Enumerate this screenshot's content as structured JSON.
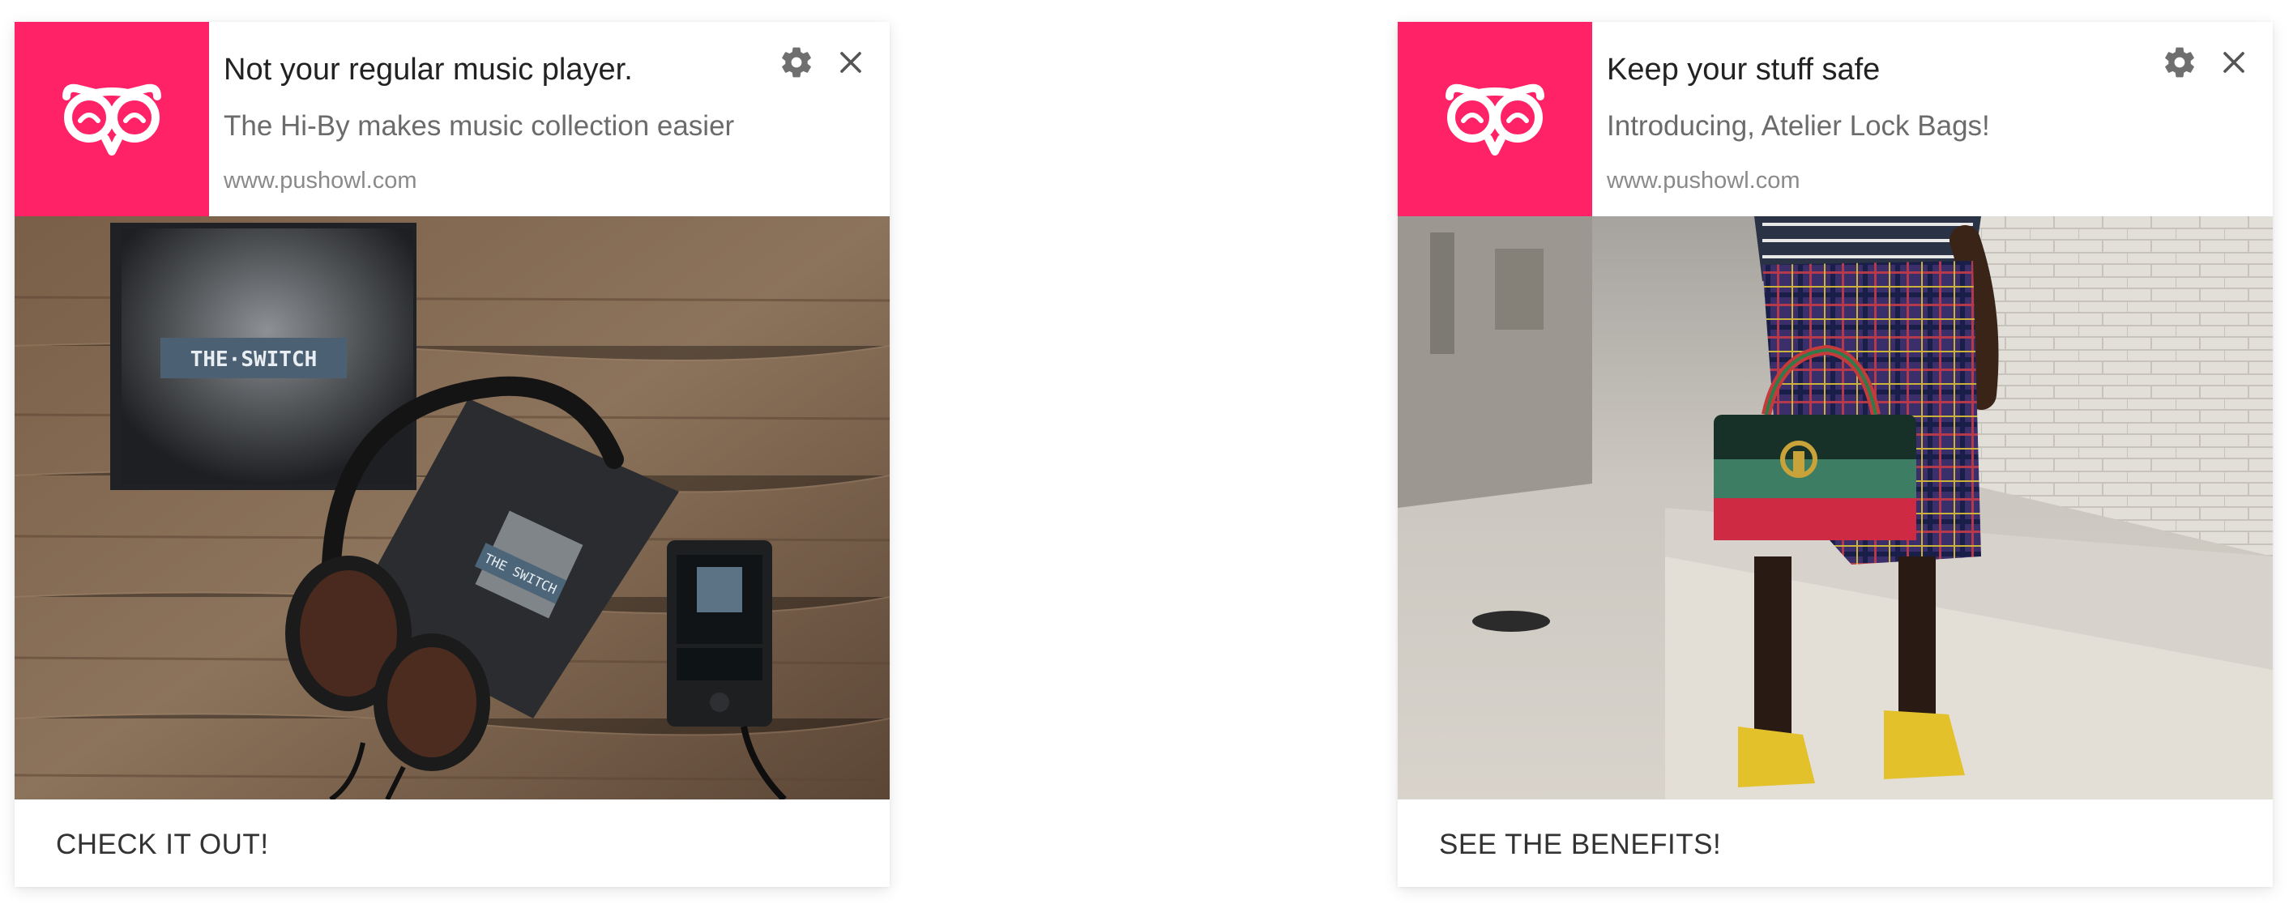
{
  "brand": {
    "accent_color": "#ff2266",
    "logo_icon": "owl-logo-icon"
  },
  "notifications": [
    {
      "title": "Not your regular music player.",
      "body": "The Hi-By makes music collection easier",
      "url": "www.pushowl.com",
      "settings_icon": "gear-icon",
      "close_icon": "close-icon",
      "image": {
        "album_text": "THE·SWITCH",
        "booklet_text": "THE SWITCH"
      },
      "action_label": "CHECK IT OUT!"
    },
    {
      "title": "Keep your stuff safe",
      "body": "Introducing, Atelier Lock Bags!",
      "url": "www.pushowl.com",
      "settings_icon": "gear-icon",
      "close_icon": "close-icon",
      "action_label": "SEE THE BENEFITS!"
    }
  ]
}
